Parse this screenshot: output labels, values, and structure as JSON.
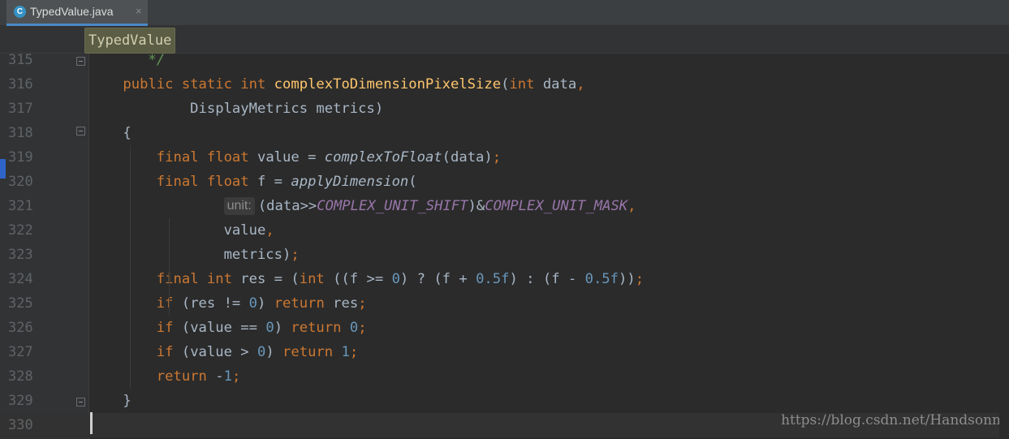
{
  "tab": {
    "icon": "java-class-icon",
    "icon_letter": "C",
    "title": "TypedValue.java",
    "close": "×"
  },
  "breadcrumb": {
    "label": "TypedValue"
  },
  "editor": {
    "lines": [
      {
        "n": "315",
        "tokens": [
          [
            "cmt",
            "       */"
          ]
        ]
      },
      {
        "n": "316",
        "tokens": [
          [
            "",
            "    "
          ],
          [
            "kw",
            "public static int "
          ],
          [
            "fn",
            "complexToDimensionPixelSize"
          ],
          [
            "",
            "("
          ],
          [
            "kw",
            "int "
          ],
          [
            "",
            "data"
          ],
          [
            "kw",
            ","
          ]
        ]
      },
      {
        "n": "317",
        "tokens": [
          [
            "",
            "            DisplayMetrics metrics)"
          ]
        ]
      },
      {
        "n": "318",
        "tokens": [
          [
            "",
            "    {"
          ]
        ]
      },
      {
        "n": "319",
        "tokens": [
          [
            "",
            "        "
          ],
          [
            "kw",
            "final float "
          ],
          [
            "",
            "value = "
          ],
          [
            "it",
            "complexToFloat"
          ],
          [
            "",
            "(data)"
          ],
          [
            "kw",
            ";"
          ]
        ]
      },
      {
        "n": "320",
        "tokens": [
          [
            "",
            "        "
          ],
          [
            "kw",
            "final float "
          ],
          [
            "",
            "f = "
          ],
          [
            "it",
            "applyDimension"
          ],
          [
            "",
            "("
          ]
        ]
      },
      {
        "n": "321",
        "tokens": [
          [
            "",
            "                "
          ],
          [
            "hint",
            "unit:"
          ],
          [
            "",
            "(data>>"
          ],
          [
            "const",
            "COMPLEX_UNIT_SHIFT"
          ],
          [
            "",
            ")&"
          ],
          [
            "const",
            "COMPLEX_UNIT_MASK"
          ],
          [
            "kw",
            ","
          ]
        ]
      },
      {
        "n": "322",
        "tokens": [
          [
            "",
            "                value"
          ],
          [
            "kw",
            ","
          ]
        ]
      },
      {
        "n": "323",
        "tokens": [
          [
            "",
            "                metrics)"
          ],
          [
            "kw",
            ";"
          ]
        ]
      },
      {
        "n": "324",
        "tokens": [
          [
            "",
            "        "
          ],
          [
            "kw",
            "final int "
          ],
          [
            "",
            "res = ("
          ],
          [
            "kw",
            "int"
          ],
          [
            "",
            " ((f >= "
          ],
          [
            "num",
            "0"
          ],
          [
            "",
            ") ? (f + "
          ],
          [
            "num",
            "0.5f"
          ],
          [
            "",
            ") : (f - "
          ],
          [
            "num",
            "0.5f"
          ],
          [
            "",
            "))"
          ],
          [
            "kw",
            ";"
          ]
        ]
      },
      {
        "n": "325",
        "tokens": [
          [
            "",
            "        "
          ],
          [
            "kw",
            "if "
          ],
          [
            "",
            "(res != "
          ],
          [
            "num",
            "0"
          ],
          [
            "",
            ") "
          ],
          [
            "kw",
            "return "
          ],
          [
            "",
            "res"
          ],
          [
            "kw",
            ";"
          ]
        ]
      },
      {
        "n": "326",
        "tokens": [
          [
            "",
            "        "
          ],
          [
            "kw",
            "if "
          ],
          [
            "",
            "(value == "
          ],
          [
            "num",
            "0"
          ],
          [
            "",
            ") "
          ],
          [
            "kw",
            "return "
          ],
          [
            "num",
            "0"
          ],
          [
            "kw",
            ";"
          ]
        ]
      },
      {
        "n": "327",
        "tokens": [
          [
            "",
            "        "
          ],
          [
            "kw",
            "if "
          ],
          [
            "",
            "(value > "
          ],
          [
            "num",
            "0"
          ],
          [
            "",
            ") "
          ],
          [
            "kw",
            "return "
          ],
          [
            "num",
            "1"
          ],
          [
            "kw",
            ";"
          ]
        ]
      },
      {
        "n": "328",
        "tokens": [
          [
            "",
            "        "
          ],
          [
            "kw",
            "return "
          ],
          [
            "",
            "-"
          ],
          [
            "num",
            "1"
          ],
          [
            "kw",
            ";"
          ]
        ]
      },
      {
        "n": "329",
        "tokens": [
          [
            "",
            "    }"
          ]
        ]
      },
      {
        "n": "330",
        "tokens": [
          [
            "",
            ""
          ]
        ]
      }
    ],
    "current_line": "330"
  },
  "watermark": "https://blog.csdn.net/Handsonn",
  "colors": {
    "background": "#2b2b2b",
    "keyword": "#cc7832",
    "method_decl": "#ffc66d",
    "constant": "#9876aa",
    "number": "#6897bb",
    "comment": "#629755",
    "text": "#a9b7c6",
    "tab_underline": "#4a88c7"
  }
}
